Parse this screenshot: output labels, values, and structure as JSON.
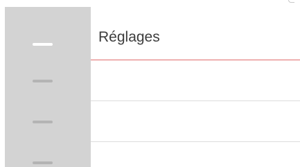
{
  "app": {
    "title": "Réglages"
  },
  "nav_rail": {
    "items": [
      {
        "id": "rail-item-1",
        "active": true
      },
      {
        "id": "rail-item-2",
        "active": false
      },
      {
        "id": "rail-item-3",
        "active": false
      },
      {
        "id": "rail-item-4",
        "active": false
      }
    ]
  },
  "settings_panel": {
    "rows": [
      {
        "label": ""
      },
      {
        "label": ""
      }
    ]
  },
  "colors": {
    "rail_background": "#d3d3d3",
    "rail_item_active": "#ffffff",
    "rail_item_inactive": "#b4b4b4",
    "header_divider": "#e06a6a",
    "row_divider": "#dcdcdc",
    "title_text": "#3c3c3c"
  }
}
